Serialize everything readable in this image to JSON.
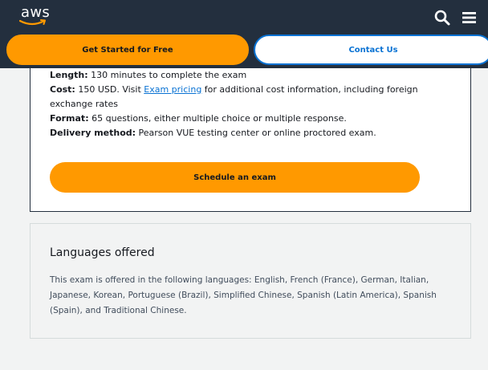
{
  "nav": {
    "logo_text": "aws",
    "search_icon": "search-icon",
    "menu_icon": "hamburger-menu-icon"
  },
  "cta": {
    "primary_label": "Get Started for Free",
    "secondary_label": "Contact Us"
  },
  "exam": {
    "length_label": "Length:",
    "length_value": " 130 minutes to complete the exam",
    "cost_label": "Cost:",
    "cost_value_before": " 150 USD. Visit ",
    "cost_link": "Exam pricing",
    "cost_value_after": " for additional cost information, including foreign exchange rates",
    "format_label": "Format:",
    "format_value": " 65 questions, either multiple choice or multiple response.",
    "delivery_label": "Delivery method:",
    "delivery_value": " Pearson VUE testing center or online proctored exam.",
    "schedule_label": "Schedule an exam"
  },
  "languages": {
    "title": "Languages offered",
    "body": "This exam is offered in the following languages: English, French (France), German, Italian, Japanese, Korean, Portuguese (Brazil), Simplified Chinese, Spanish (Latin America), Spanish (Spain), and Traditional Chinese."
  },
  "colors": {
    "nav_bg": "#232f3e",
    "accent_orange": "#ff9900",
    "link_blue": "#0972d3",
    "page_bg": "#f2f3f3"
  }
}
